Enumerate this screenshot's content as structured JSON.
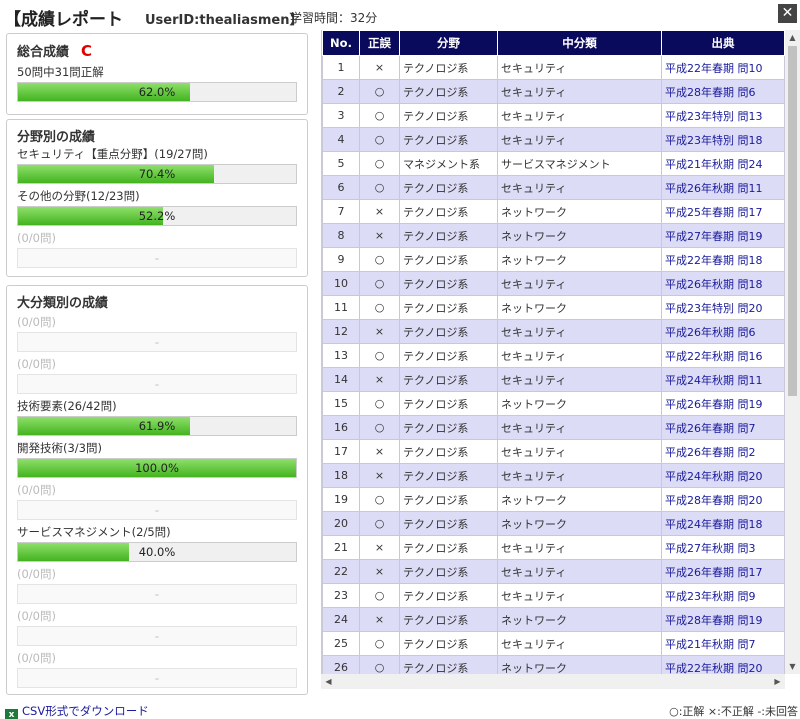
{
  "header": {
    "title": "【成績レポート",
    "user": "UserID:thealiasmen】",
    "study_time": "学習時間：32分",
    "close": "✕"
  },
  "overall": {
    "title": "総合成績",
    "grade": "C",
    "summary": "50問中31問正解",
    "percent_text": "62.0%",
    "percent": 62.0
  },
  "field_section": {
    "title": "分野別の成績",
    "items": [
      {
        "label": "セキュリティ【重点分野】(19/27問)",
        "value": "70.4%",
        "pct": 70.4,
        "empty": false
      },
      {
        "label": "その他の分野(12/23問)",
        "value": "52.2%",
        "pct": 52.2,
        "empty": false
      },
      {
        "label": "(0/0問)",
        "value": "-",
        "pct": 0,
        "empty": true
      }
    ]
  },
  "major_section": {
    "title": "大分類別の成績",
    "items": [
      {
        "label": "(0/0問)",
        "value": "-",
        "pct": 0,
        "empty": true
      },
      {
        "label": "(0/0問)",
        "value": "-",
        "pct": 0,
        "empty": true
      },
      {
        "label": "技術要素(26/42問)",
        "value": "61.9%",
        "pct": 61.9,
        "empty": false
      },
      {
        "label": "開発技術(3/3問)",
        "value": "100.0%",
        "pct": 100.0,
        "empty": false
      },
      {
        "label": "(0/0問)",
        "value": "-",
        "pct": 0,
        "empty": true
      },
      {
        "label": "サービスマネジメント(2/5問)",
        "value": "40.0%",
        "pct": 40.0,
        "empty": false
      },
      {
        "label": "(0/0問)",
        "value": "-",
        "pct": 0,
        "empty": true
      },
      {
        "label": "(0/0問)",
        "value": "-",
        "pct": 0,
        "empty": true
      },
      {
        "label": "(0/0問)",
        "value": "-",
        "pct": 0,
        "empty": true
      }
    ]
  },
  "table": {
    "columns": [
      "No.",
      "正誤",
      "分野",
      "中分類",
      "出典"
    ],
    "rows": [
      [
        "1",
        "×",
        "テクノロジ系",
        "セキュリティ",
        "平成22年春期 問10"
      ],
      [
        "2",
        "○",
        "テクノロジ系",
        "セキュリティ",
        "平成28年春期 問6"
      ],
      [
        "3",
        "○",
        "テクノロジ系",
        "セキュリティ",
        "平成23年特別 問13"
      ],
      [
        "4",
        "○",
        "テクノロジ系",
        "セキュリティ",
        "平成23年特別 問18"
      ],
      [
        "5",
        "○",
        "マネジメント系",
        "サービスマネジメント",
        "平成21年秋期 問24"
      ],
      [
        "6",
        "○",
        "テクノロジ系",
        "セキュリティ",
        "平成26年秋期 問11"
      ],
      [
        "7",
        "×",
        "テクノロジ系",
        "ネットワーク",
        "平成25年春期 問17"
      ],
      [
        "8",
        "×",
        "テクノロジ系",
        "ネットワーク",
        "平成27年春期 問19"
      ],
      [
        "9",
        "○",
        "テクノロジ系",
        "ネットワーク",
        "平成22年春期 問18"
      ],
      [
        "10",
        "○",
        "テクノロジ系",
        "セキュリティ",
        "平成26年秋期 問18"
      ],
      [
        "11",
        "○",
        "テクノロジ系",
        "ネットワーク",
        "平成23年特別 問20"
      ],
      [
        "12",
        "×",
        "テクノロジ系",
        "セキュリティ",
        "平成26年秋期 問6"
      ],
      [
        "13",
        "○",
        "テクノロジ系",
        "セキュリティ",
        "平成22年秋期 問16"
      ],
      [
        "14",
        "×",
        "テクノロジ系",
        "セキュリティ",
        "平成24年秋期 問11"
      ],
      [
        "15",
        "○",
        "テクノロジ系",
        "ネットワーク",
        "平成26年春期 問19"
      ],
      [
        "16",
        "○",
        "テクノロジ系",
        "セキュリティ",
        "平成26年春期 問7"
      ],
      [
        "17",
        "×",
        "テクノロジ系",
        "セキュリティ",
        "平成26年春期 問2"
      ],
      [
        "18",
        "×",
        "テクノロジ系",
        "セキュリティ",
        "平成24年秋期 問20"
      ],
      [
        "19",
        "○",
        "テクノロジ系",
        "ネットワーク",
        "平成28年春期 問20"
      ],
      [
        "20",
        "○",
        "テクノロジ系",
        "ネットワーク",
        "平成24年春期 問18"
      ],
      [
        "21",
        "×",
        "テクノロジ系",
        "セキュリティ",
        "平成27年秋期 問3"
      ],
      [
        "22",
        "×",
        "テクノロジ系",
        "セキュリティ",
        "平成26年春期 問17"
      ],
      [
        "23",
        "○",
        "テクノロジ系",
        "セキュリティ",
        "平成23年秋期 問9"
      ],
      [
        "24",
        "×",
        "テクノロジ系",
        "ネットワーク",
        "平成28年春期 問19"
      ],
      [
        "25",
        "○",
        "テクノロジ系",
        "セキュリティ",
        "平成21年秋期 問7"
      ],
      [
        "26",
        "○",
        "テクノロジ系",
        "ネットワーク",
        "平成22年秋期 問20"
      ]
    ]
  },
  "footer": {
    "csv_label": "CSV形式でダウンロード",
    "legend": "○:正解 ×:不正解 -:未回答"
  }
}
